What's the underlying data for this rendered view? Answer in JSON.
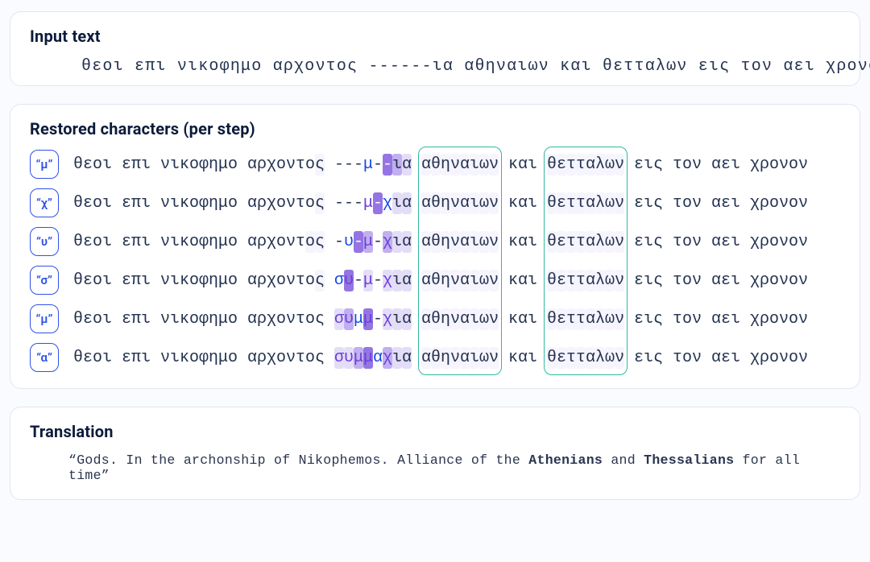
{
  "cards": {
    "input_title": "Input text",
    "restored_title": "Restored characters (per step)",
    "translation_title": "Translation"
  },
  "input_text": "θεοι επι νικοφημο αρχοντος ------ια αθηναιων και θετταλων εις τον αει χρονον",
  "prefix_words": [
    "θεοι",
    "επι",
    "νικοφημο",
    "αρχοντος"
  ],
  "suffix_words": [
    "αθηναιων",
    "και",
    "θετταλων",
    "εις",
    "τον",
    "αει",
    "χρονον"
  ],
  "suffix_purple_faint_idx": [
    0,
    2
  ],
  "attention_boxes_words": [
    0,
    2
  ],
  "restored_header_faint": [
    6,
    7
  ],
  "steps": [
    {
      "chip_label": "“μ”",
      "mid_chars": [
        "-",
        "-",
        "-",
        "μ",
        "-",
        "-",
        "ι",
        "α"
      ],
      "blue_idx": [
        3
      ],
      "purple_idx": [],
      "shades": [
        "",
        "",
        "",
        "",
        "",
        "hl-s3",
        "hl-s2",
        "hl-s1"
      ],
      "prefix_faint_cols": [
        7
      ]
    },
    {
      "chip_label": "“χ”",
      "mid_chars": [
        "-",
        "-",
        "-",
        "μ",
        "-",
        "χ",
        "ι",
        "α"
      ],
      "blue_idx": [
        5
      ],
      "purple_idx": [
        3
      ],
      "shades": [
        "",
        "",
        "",
        "",
        "hl-s3",
        "",
        "hl-s1",
        "hl-s1"
      ],
      "prefix_faint_cols": [
        7
      ]
    },
    {
      "chip_label": "“υ”",
      "mid_chars": [
        "-",
        "υ",
        "-",
        "μ",
        "-",
        "χ",
        "ι",
        "α"
      ],
      "blue_idx": [
        1
      ],
      "purple_idx": [
        3,
        5
      ],
      "shades": [
        "",
        "",
        "hl-s3",
        "hl-s2",
        "",
        "hl-s2",
        "hl-s1",
        "hl-s1"
      ],
      "prefix_faint_cols": [
        6,
        7
      ]
    },
    {
      "chip_label": "“σ”",
      "mid_chars": [
        "σ",
        "υ",
        "-",
        "μ",
        "-",
        "χ",
        "ι",
        "α"
      ],
      "blue_idx": [
        0
      ],
      "purple_idx": [
        1,
        3,
        5
      ],
      "shades": [
        "",
        "hl-s3",
        "",
        "hl-s1",
        "",
        "hl-s1",
        "hl-s1",
        "hl-s1"
      ],
      "prefix_faint_cols": [
        7
      ]
    },
    {
      "chip_label": "“μ”",
      "mid_chars": [
        "σ",
        "υ",
        "μ",
        "μ",
        "-",
        "χ",
        "ι",
        "α"
      ],
      "blue_idx": [
        2
      ],
      "purple_idx": [
        0,
        1,
        3,
        5
      ],
      "shades": [
        "hl-s1",
        "hl-s2",
        "",
        "hl-s3",
        "",
        "hl-s1",
        "hl-s1",
        "hl-s1"
      ],
      "prefix_faint_cols": []
    },
    {
      "chip_label": "“α”",
      "mid_chars": [
        "σ",
        "υ",
        "μ",
        "μ",
        "α",
        "χ",
        "ι",
        "α"
      ],
      "blue_idx": [
        4
      ],
      "purple_idx": [
        0,
        1,
        2,
        3,
        5
      ],
      "shades": [
        "hl-s1",
        "hl-s1",
        "hl-s2",
        "hl-s3",
        "",
        "hl-s2",
        "hl-s1",
        "hl-s1"
      ],
      "prefix_faint_cols": []
    }
  ],
  "translation": {
    "pre": "“Gods. In the archonship of Nikophemos. Alliance of the ",
    "b1": "Athenians",
    "mid": " and ",
    "b2": "Thessalians",
    "post": " for all time”"
  }
}
